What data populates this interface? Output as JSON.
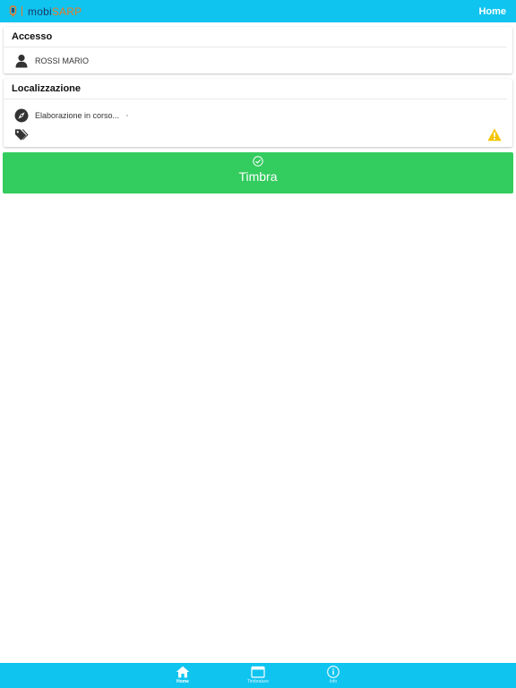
{
  "app": {
    "brand_mobi": "mobi",
    "brand_sarp": "SARP",
    "header_title": "Home"
  },
  "accesso": {
    "title": "Accesso",
    "user_name": "ROSSI MARIO",
    "icon": "user-icon"
  },
  "localizzazione": {
    "title": "Localizzazione",
    "status": "Elaborazione in corso...",
    "icons": [
      "compass-icon",
      "tags-icon",
      "warning-icon"
    ]
  },
  "action": {
    "label": "Timbra",
    "icon": "check-circle-icon"
  },
  "tabs": [
    {
      "label": "Home",
      "icon": "home-icon",
      "active": true
    },
    {
      "label": "Timbrature",
      "icon": "calendar-icon",
      "active": false
    },
    {
      "label": "Info",
      "icon": "info-icon",
      "active": false
    }
  ],
  "colors": {
    "accent": "#10c4f0",
    "action_green": "#33cc5e",
    "warning": "#f5c400",
    "brand_orange": "#e87722"
  }
}
